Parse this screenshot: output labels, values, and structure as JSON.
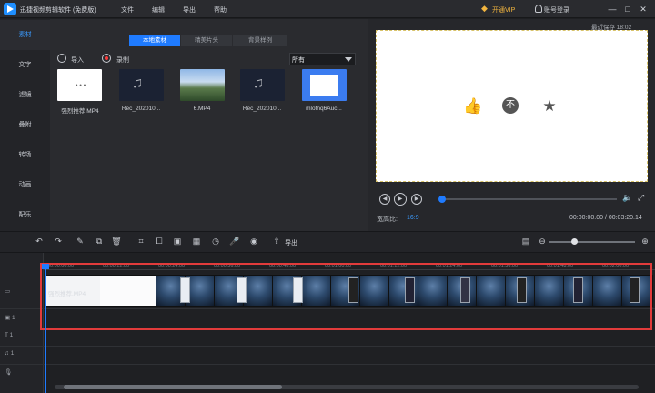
{
  "app": {
    "title": "迅捷视频剪辑软件 (免费版)",
    "menu": [
      "文件",
      "编辑",
      "导出",
      "帮助"
    ],
    "vip_label": "开通VIP",
    "login_label": "账号登录",
    "window_controls": [
      "minimize-icon",
      "maximize-icon",
      "close-icon"
    ]
  },
  "left_nav": {
    "items": [
      {
        "label": "素材",
        "active": true
      },
      {
        "label": "文字",
        "active": false
      },
      {
        "label": "滤镜",
        "active": false
      },
      {
        "label": "叠附",
        "active": false
      },
      {
        "label": "转场",
        "active": false
      },
      {
        "label": "动画",
        "active": false
      },
      {
        "label": "配乐",
        "active": false
      }
    ]
  },
  "media": {
    "tabs": [
      {
        "label": "本地素材",
        "active": true
      },
      {
        "label": "精美片头",
        "active": false
      },
      {
        "label": "背景样例",
        "active": false
      }
    ],
    "import_label": "导入",
    "record_label": "录制",
    "filter_value": "所有",
    "items": [
      {
        "label": "强烈推荐.MP4",
        "kind": "video"
      },
      {
        "label": "Rec_202010...",
        "kind": "audio"
      },
      {
        "label": "6.MP4",
        "kind": "video"
      },
      {
        "label": "Rec_202010...",
        "kind": "audio"
      },
      {
        "label": "mlofnq6Auc...",
        "kind": "image"
      }
    ]
  },
  "preview": {
    "last_save": "最近保存 18:02",
    "ratio_label": "宽高比:",
    "ratio_value": "16:9",
    "time_readout": "00:00:00.00 / 00:03:20.14"
  },
  "toolbar": {
    "export_label": "导出"
  },
  "timeline": {
    "ruler_ticks": [
      "00:00:00.00",
      "00:00:12.00",
      "00:00:24.00",
      "00:00:36.00",
      "00:00:48.00",
      "00:01:00.00",
      "00:01:12.00",
      "00:01:24.00",
      "00:01:36.00",
      "00:01:48.00",
      "00:02:00.00"
    ],
    "clip_name": "强烈推荐.MP4",
    "track_labels": [
      "1",
      "1",
      "1"
    ]
  },
  "colors": {
    "accent": "#1f7bff",
    "highlight": "#e23b3b",
    "vip": "#f2b53f"
  }
}
